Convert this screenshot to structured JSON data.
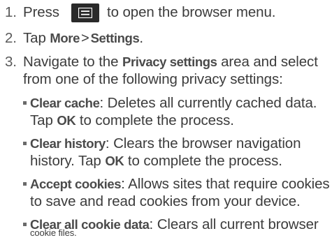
{
  "steps": [
    {
      "number": "1.",
      "prefix": "Press",
      "icon": "menu-key-icon",
      "suffix": "to open the browser menu."
    },
    {
      "number": "2.",
      "prefix": "Tap ",
      "cmd1": "More",
      "sep": ">",
      "cmd2": "Settings",
      "suffix": "."
    },
    {
      "number": "3.",
      "line1_prefix": "Navigate to the ",
      "line1_cmd": "Privacy settings",
      "line1_suffix": " area and select",
      "line2": "from one of the following privacy settings:"
    }
  ],
  "options": [
    {
      "name": "Clear cache",
      "line1_rest": ": Deletes all currently cached data.",
      "line2_prefix": "Tap ",
      "line2_cmd": "OK",
      "line2_suffix": " to complete the process."
    },
    {
      "name": "Clear history",
      "line1_rest": ": Clears the browser navigation",
      "line2_prefix": "history. Tap ",
      "line2_cmd": "OK",
      "line2_suffix": " to complete the process."
    },
    {
      "name": "Accept cookies",
      "line1_rest": ": Allows sites that require cookies",
      "line2": "to save and read cookies from your device."
    },
    {
      "name": "Clear all cookie data",
      "line1_rest": ": Clears all current browser",
      "line2": "cookie files."
    }
  ],
  "colors": {
    "text": "#3c3c3c",
    "menu_key_bg": "#2a2a2a",
    "menu_key_glyph": "#ffffff"
  }
}
